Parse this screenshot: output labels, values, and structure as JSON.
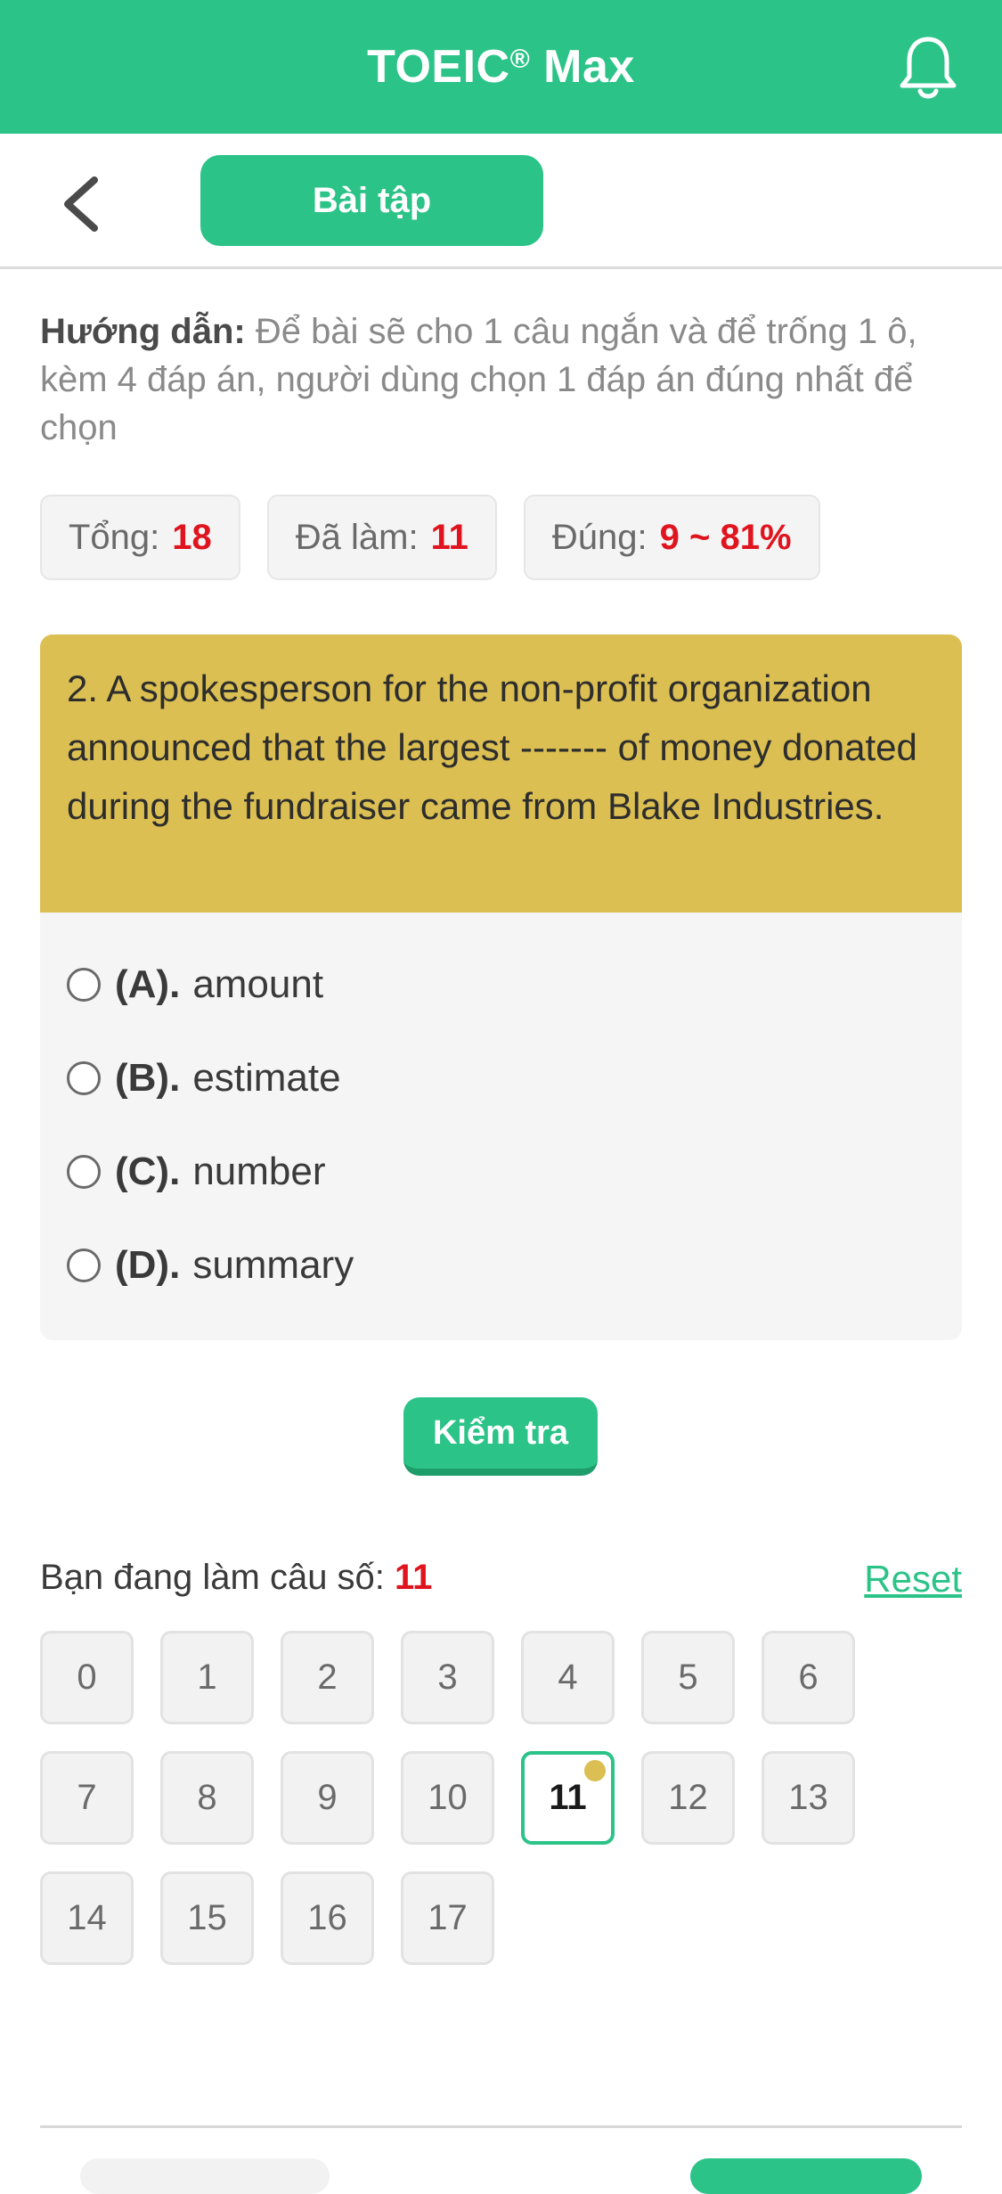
{
  "header": {
    "app_title": "TOEIC",
    "app_title_mark": "®",
    "app_title_suffix": " Max",
    "bell_icon": "bell-icon"
  },
  "subheader": {
    "back_icon": "chevron-left-icon",
    "tab_label": "Bài tập"
  },
  "guide": {
    "label": "Hướng dẫn:",
    "text": " Để bài sẽ cho 1 câu ngắn và để trống 1 ô, kèm 4 đáp án, người dùng chọn 1 đáp án đúng nhất để chọn"
  },
  "stats": {
    "total_label": "Tổng:",
    "total_value": "18",
    "done_label": "Đã làm:",
    "done_value": "11",
    "correct_label": "Đúng:",
    "correct_value": "9 ~ 81%"
  },
  "question": {
    "text": "2. A spokesperson for the non-profit organization announced that the largest ------- of money donated during the fundraiser came from Blake Industries.",
    "options": [
      {
        "letter": "(A).",
        "text": "amount"
      },
      {
        "letter": "(B).",
        "text": "estimate"
      },
      {
        "letter": "(C).",
        "text": "number"
      },
      {
        "letter": "(D).",
        "text": "summary"
      }
    ]
  },
  "check_button": "Kiểm tra",
  "navigator": {
    "current_label": "Bạn đang làm câu số:",
    "current_value": "11",
    "reset_label": "Reset",
    "cells": [
      "0",
      "1",
      "2",
      "3",
      "4",
      "5",
      "6",
      "7",
      "8",
      "9",
      "10",
      "11",
      "12",
      "13",
      "14",
      "15",
      "16",
      "17"
    ],
    "active_cell": "11"
  },
  "colors": {
    "brand": "#2cc388",
    "question_bg": "#dbbf52",
    "highlight": "#e0141e"
  }
}
